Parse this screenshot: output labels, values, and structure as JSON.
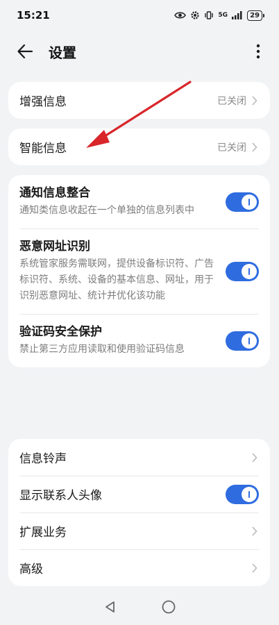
{
  "status_bar": {
    "time": "15:21",
    "network": "5G",
    "battery": "29",
    "icons": [
      "eye-icon",
      "vibrate-icon",
      "signal-icon",
      "battery-icon"
    ]
  },
  "header": {
    "title": "设置",
    "back_icon": "arrow-left-icon",
    "more_icon": "more-vertical-icon"
  },
  "cards": {
    "enhanced": {
      "label": "增强信息",
      "value": "已关闭"
    },
    "smart": {
      "label": "智能信息",
      "value": "已关闭"
    },
    "notify": {
      "title": "通知信息整合",
      "desc": "通知类信息收起在一个单独的信息列表中",
      "enabled": true
    },
    "malicious": {
      "title": "恶意网址识别",
      "desc": "系统管家服务需联网，提供设备标识符、广告标识符、系统、设备的基本信息、网址，用于识别恶意网址、统计并优化该功能",
      "enabled": true
    },
    "captcha": {
      "title": "验证码安全保护",
      "desc": "禁止第三方应用读取和使用验证码信息",
      "enabled": true
    },
    "ringtone": {
      "label": "信息铃声"
    },
    "avatar": {
      "label": "显示联系人头像",
      "enabled": true
    },
    "extended": {
      "label": "扩展业务"
    },
    "advanced": {
      "label": "高级"
    }
  },
  "colors": {
    "accent": "#2f6ce0",
    "annotation": "#d8262a",
    "background": "#f1f3f5",
    "card": "#ffffff"
  },
  "nav_bar": {
    "icons": [
      "back-triangle-icon",
      "home-circle-icon"
    ]
  }
}
